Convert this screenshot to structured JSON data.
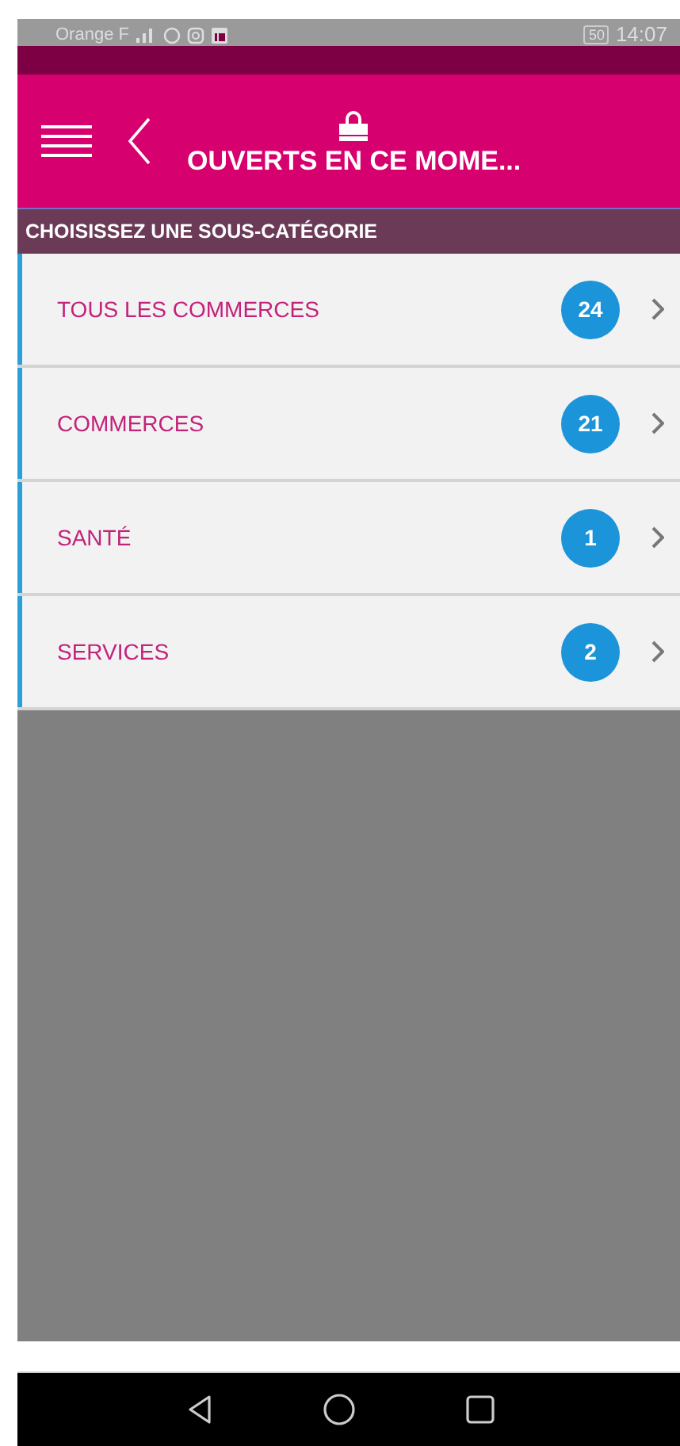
{
  "status_bar": {
    "carrier": "Orange F",
    "battery": "50",
    "time": "14:07"
  },
  "header": {
    "title": "OUVERTS EN CE MOME..."
  },
  "subheader": "CHOISISSEZ UNE SOUS-CATÉGORIE",
  "categories": [
    {
      "label": "TOUS LES COMMERCES",
      "count": "24"
    },
    {
      "label": "COMMERCES",
      "count": "21"
    },
    {
      "label": "SANTÉ",
      "count": "1"
    },
    {
      "label": "SERVICES",
      "count": "2"
    }
  ]
}
